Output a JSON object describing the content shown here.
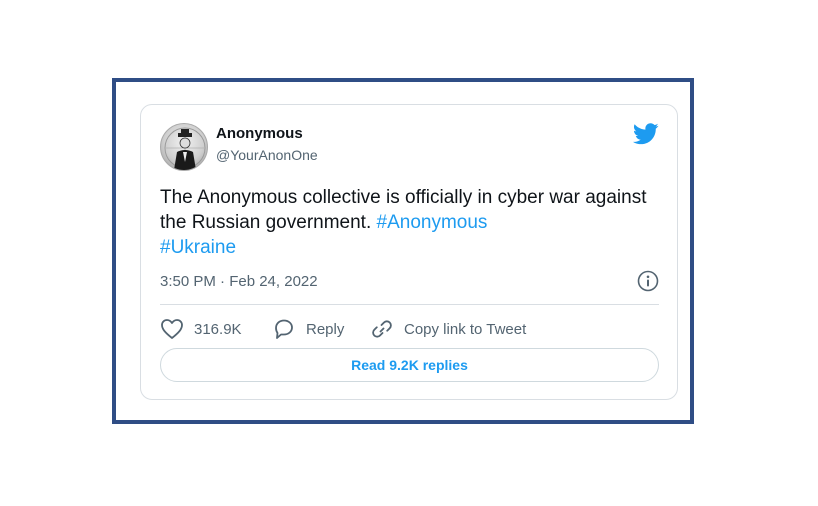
{
  "tweet": {
    "author_name": "Anonymous",
    "author_handle": "@YourAnonOne",
    "text_plain": "The Anonymous collective is officially in cyber war against the Russian government. ",
    "hashtag_1": "#Anonymous",
    "hashtag_2": "#Ukraine",
    "timestamp": "3:50 PM · Feb 24, 2022",
    "likes_count": "316.9K",
    "reply_label": "Reply",
    "copy_link_label": "Copy link to Tweet",
    "read_replies_label": "Read 9.2K replies"
  },
  "icons": {
    "brand": "twitter-bird-icon",
    "info": "info-icon",
    "like": "heart-icon",
    "reply": "reply-bubble-icon",
    "link": "link-icon"
  },
  "colors": {
    "frame_border": "#2f4d85",
    "accent": "#1d9bf0",
    "text_primary": "#0f1419",
    "text_secondary": "#536471"
  }
}
